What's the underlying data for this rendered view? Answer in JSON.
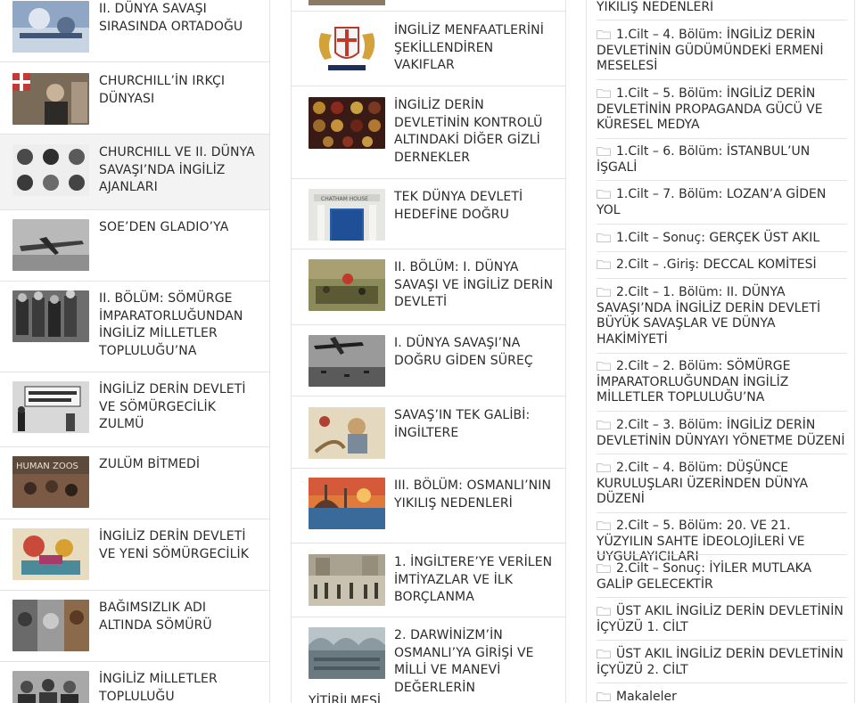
{
  "left_column": {
    "items": [
      {
        "title": "II. DÜNYA SAVAŞI SIRASINDA ORTADOĞU",
        "thumb": "ww2-middle-east-image"
      },
      {
        "title": "CHURCHILL’İN IRKÇI DÜNYASI",
        "thumb": "churchill-collage-image"
      },
      {
        "title": "CHURCHILL VE II. DÜNYA SAVAŞI’NDA İNGİLİZ AJANLARI",
        "thumb": "agents-portraits-image"
      },
      {
        "title": "SOE’DEN GLADIO’YA",
        "thumb": "fighter-plane-image"
      },
      {
        "title": "II. BÖLÜM: SÖMÜRGE İMPARATORLUĞUNDAN İNGİLİZ MİLLETLER TOPLULUĞU’NA",
        "thumb": "commonwealth-meeting-image"
      },
      {
        "title": "İNGİLİZ DERİN DEVLETİ VE SÖMÜRGECİLİK ZULMÜ",
        "thumb": "protest-sign-image"
      },
      {
        "title": "ZULÜM BİTMEDİ",
        "thumb": "human-zoos-image"
      },
      {
        "title": "İNGİLİZ DERİN DEVLETİ VE YENİ SÖMÜRGECİLİK",
        "thumb": "colonial-cartoon-image"
      },
      {
        "title": "BAĞIMSIZLIK ADI ALTINDA SÖMÜRÜ",
        "thumb": "independence-collage-image"
      },
      {
        "title": "İNGİLİZ MİLLETLER TOPLULUĞU",
        "thumb": "commonwealth-leaders-image"
      }
    ]
  },
  "middle_column": {
    "items": [
      {
        "title": "İNGİLİZ MENFAATLERİNİ ŞEKİLLENDİREN VAKIFLAR",
        "thumb": "east-india-company-crest"
      },
      {
        "title": "İNGİLİZ DERİN DEVLETİNİN KONTROLÜ ALTINDAKİ DİĞER GİZLİ DERNEKLER",
        "thumb": "secret-society-symbols"
      },
      {
        "title": "TEK DÜNYA DEVLETİ HEDEFİNE DOĞRU",
        "thumb": "chatham-house-door"
      },
      {
        "title": "II. BÖLÜM: I. DÜNYA SAVAŞI VE İNGİLİZ DERİN DEVLETİ",
        "thumb": "battle-painting-image"
      },
      {
        "title": "I. DÜNYA SAVAŞI’NA DOĞRU GİDEN SÜREÇ",
        "thumb": "bomber-planes-image"
      },
      {
        "title": "SAVAŞ’IN TEK GALİBİ: İNGİLTERE",
        "thumb": "war-cartoon-image"
      },
      {
        "title": "III. BÖLÜM: OSMANLI’NIN YIKILIŞ NEDENLERİ",
        "thumb": "istanbul-sunset-image"
      },
      {
        "title": "1. İNGİLTERE’YE VERİLEN İMTİYAZLAR VE İLK BORÇLANMA",
        "thumb": "ottoman-parade-image"
      },
      {
        "title": "2. DARWİNİZM’İN OSMANLI’YA GİRİŞİ VE MİLLİ VE MANEVİ DEĞERLERİN",
        "thumb": "ottoman-assembly-image"
      }
    ],
    "last_line": "YİTİRİLMESİ"
  },
  "right_column": {
    "top_text": "YIKILIŞ NEDENLERİ",
    "links": [
      {
        "label": "1.Cilt – 4. Bölüm: İNGİLİZ DERİN DEVLETİNİN GÜDÜMÜNDEKİ ERMENİ MESELESİ"
      },
      {
        "label": "1.Cilt – 5. Bölüm: İNGİLİZ DERİN DEVLETİNİN PROPAGANDA GÜCÜ VE KÜRESEL MEDYA"
      },
      {
        "label": "1.Cilt – 6. Bölüm: İSTANBUL’UN İŞGALİ"
      },
      {
        "label": "1.Cilt – 7. Bölüm: LOZAN’A GİDEN YOL"
      },
      {
        "label": "1.Cilt – Sonuç: GERÇEK ÜST AKIL"
      },
      {
        "label": "2.Cilt – .Giriş: DECCAL KOMİTESİ"
      },
      {
        "label": "2.Cilt – 1. Bölüm: II. DÜNYA SAVAŞI’NDA İNGİLİZ DERİN DEVLETİ BÜYÜK SAVAŞLAR VE DÜNYA HAKİMİYETİ"
      },
      {
        "label": "2.Cilt – 2. Bölüm: SÖMÜRGE İMPARATORLUĞUNDAN İNGİLİZ MİLLETLER TOPLULUĞU’NA"
      },
      {
        "label": "2.Cilt – 3. Bölüm: İNGİLİZ DERİN DEVLETİNİN DÜNYAYI YÖNETME DÜZENİ"
      },
      {
        "label": "2.Cilt – 4. Bölüm: DÜŞÜNCE KURULUŞLARI ÜZERİNDEN DÜNYA DÜZENİ"
      },
      {
        "label": "2.Cilt – 5. Bölüm: 20. VE 21. YÜZYILIN SAHTE İDEOLOJİLERİ VE UYGULAYICILARI"
      },
      {
        "label": "2.Cilt – Sonuç: İYİLER MUTLAKA GALİP GELECEKTİR"
      },
      {
        "label": "ÜST AKIL İNGİLİZ DERİN DEVLETİNİN İÇYÜZÜ 1. CİLT"
      },
      {
        "label": "ÜST AKIL İNGİLİZ DERİN DEVLETİNİN İÇYÜZÜ 2. CİLT"
      },
      {
        "label": "Makaleler"
      }
    ],
    "icon": "folder-icon"
  },
  "colors": {
    "page_bg": "#ffffff",
    "text": "#2b2b2b",
    "divider": "#e2e2e2",
    "highlight_row": "#f3f3f3",
    "folder_icon": "#c9c9c9"
  }
}
